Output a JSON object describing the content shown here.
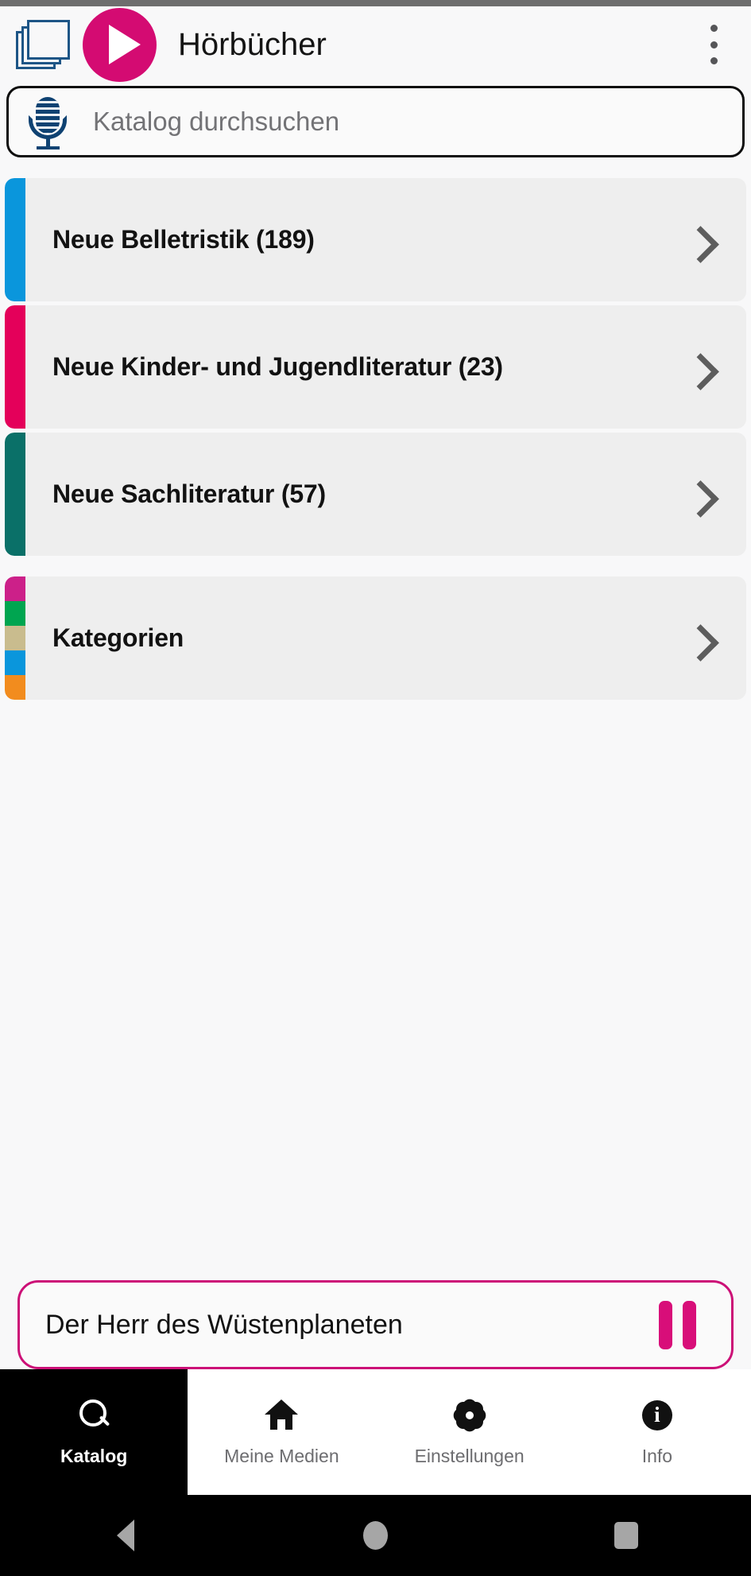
{
  "header": {
    "title": "Hörbücher",
    "books_icon": "stacked-books-icon",
    "play_icon": "play-circle-icon",
    "menu_icon": "overflow-menu-icon"
  },
  "search": {
    "placeholder": "Katalog durchsuchen",
    "value": "",
    "mic_icon": "microphone-icon"
  },
  "catalog": {
    "items": [
      {
        "label": "Neue Belletristik (189)",
        "accent": [
          "#0a96dc"
        ],
        "chevron": "chevron-right-icon"
      },
      {
        "label": "Neue Kinder- und Jugendliteratur (23)",
        "accent": [
          "#e4005a"
        ],
        "chevron": "chevron-right-icon"
      },
      {
        "label": "Neue Sachliteratur  (57)",
        "accent": [
          "#0a7068"
        ],
        "chevron": "chevron-right-icon"
      },
      {
        "label": "Kategorien",
        "accent": [
          "#cc2089",
          "#00a550",
          "#c9bc8e",
          "#0a96dc",
          "#f28c1e"
        ],
        "chevron": "chevron-right-icon"
      }
    ]
  },
  "player": {
    "title": "Der Herr des Wüstenplaneten",
    "control_icon": "pause-icon",
    "accent_color": "#cc1077"
  },
  "bottom_nav": {
    "items": [
      {
        "label": "Katalog",
        "icon": "search-icon",
        "active": true
      },
      {
        "label": "Meine Medien",
        "icon": "home-icon",
        "active": false
      },
      {
        "label": "Einstellungen",
        "icon": "gear-icon",
        "active": false
      },
      {
        "label": "Info",
        "icon": "info-icon",
        "active": false
      }
    ]
  },
  "android_nav": {
    "back": "back-triangle-icon",
    "home": "home-circle-icon",
    "recents": "recents-square-icon"
  }
}
